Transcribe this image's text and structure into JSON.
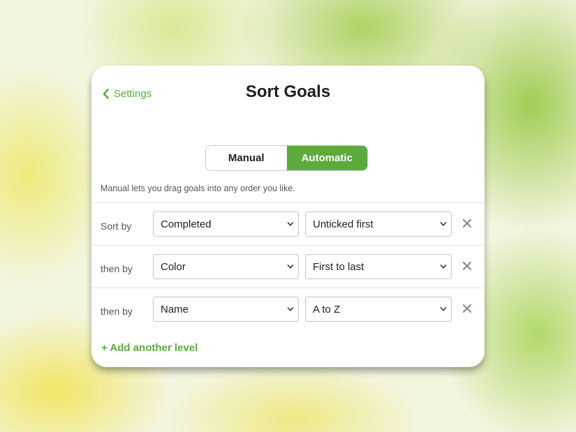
{
  "header": {
    "back_label": "Settings",
    "title": "Sort Goals"
  },
  "mode_toggle": {
    "options": [
      "Manual",
      "Automatic"
    ],
    "selected": "Automatic"
  },
  "description": "Manual lets you drag goals into any order you like.",
  "sort_levels": [
    {
      "label": "Sort by",
      "field": "Completed",
      "order": "Unticked first"
    },
    {
      "label": "then by",
      "field": "Color",
      "order": "First to last"
    },
    {
      "label": "then by",
      "field": "Name",
      "order": "A to Z"
    }
  ],
  "add_level_label": "+ Add another level",
  "colors": {
    "accent": "#5aab3c",
    "text": "#1e1e1e",
    "muted": "#555555"
  },
  "icons": {
    "back": "chevron-left-icon",
    "select": "chevron-down-icon",
    "remove": "close-icon"
  }
}
